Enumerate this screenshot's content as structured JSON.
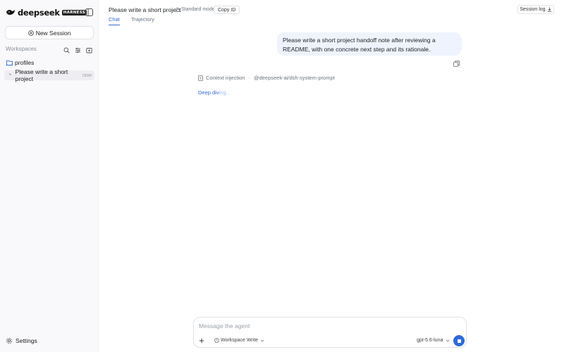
{
  "brand": {
    "name": "deepseek",
    "tag": "HARNESS"
  },
  "sidebar": {
    "new_session_label": "New Session",
    "workspaces_label": "Workspaces",
    "folder": {
      "label": "profiles",
      "icon": "folder-icon"
    },
    "sessions": [
      {
        "title": "Please write a short project",
        "time": "now"
      }
    ],
    "settings_label": "Settings"
  },
  "header": {
    "title": "Please write a short project",
    "mode": "Standard mode",
    "copy_id_label": "Copy ID",
    "session_log_label": "Session log",
    "tabs": [
      {
        "label": "Chat",
        "active": true
      },
      {
        "label": "Trajectory",
        "active": false
      }
    ]
  },
  "chat": {
    "user_message": "Please write a short project handoff note after reviewing a README, with one concrete next step and its rationale.",
    "context_label": "Context injection",
    "context_source": "@deepseek-ai/dsh-system-prompt",
    "status_text_a": "Deep div",
    "status_text_b": "ing..."
  },
  "composer": {
    "placeholder": "Message the agent",
    "workspace_mode": "Workspace Write",
    "model": "gpt-5.6-luna"
  },
  "colors": {
    "accent": "#2f6bd9",
    "bubble": "#eef3fd",
    "sidebar_bg": "#f9f9fb"
  }
}
